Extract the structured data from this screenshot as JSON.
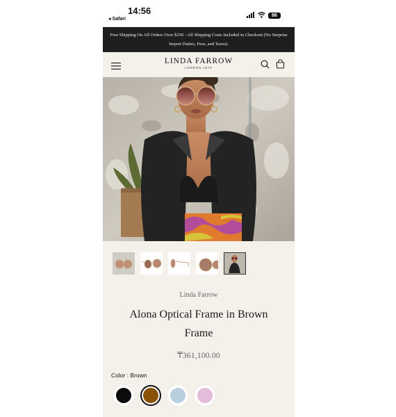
{
  "status_bar": {
    "time": "14:56",
    "back_label": "◂ Safari",
    "battery": "86"
  },
  "announcement": {
    "text": "Free Shipping On All Orders Over $250 - All Shipping Costs Included in Checkout (No Surprise Import Duties, Fees, and Taxes)."
  },
  "header": {
    "brand": "LINDA FARROW",
    "brand_sub": "LONDON 1970",
    "icons": [
      "menu-icon",
      "search-icon",
      "bag-icon"
    ]
  },
  "gallery": {
    "thumbnail_count": 5,
    "active_index": 4
  },
  "product": {
    "vendor": "Linda Farrow",
    "title": "Alona Optical Frame in Brown Frame",
    "price": "₸361,100.00",
    "color_label": "Color : Brown",
    "swatches": [
      {
        "name": "black",
        "hex": "#0b0b0b"
      },
      {
        "name": "brown",
        "hex": "#8a5206"
      },
      {
        "name": "light-blue",
        "hex": "#b9cfe0"
      },
      {
        "name": "pink",
        "hex": "#e4bcd9"
      }
    ],
    "selected_swatch": "brown"
  },
  "colors": {
    "announcement_bg": "#1e1e1e",
    "page_bg": "#f3f1ea"
  }
}
